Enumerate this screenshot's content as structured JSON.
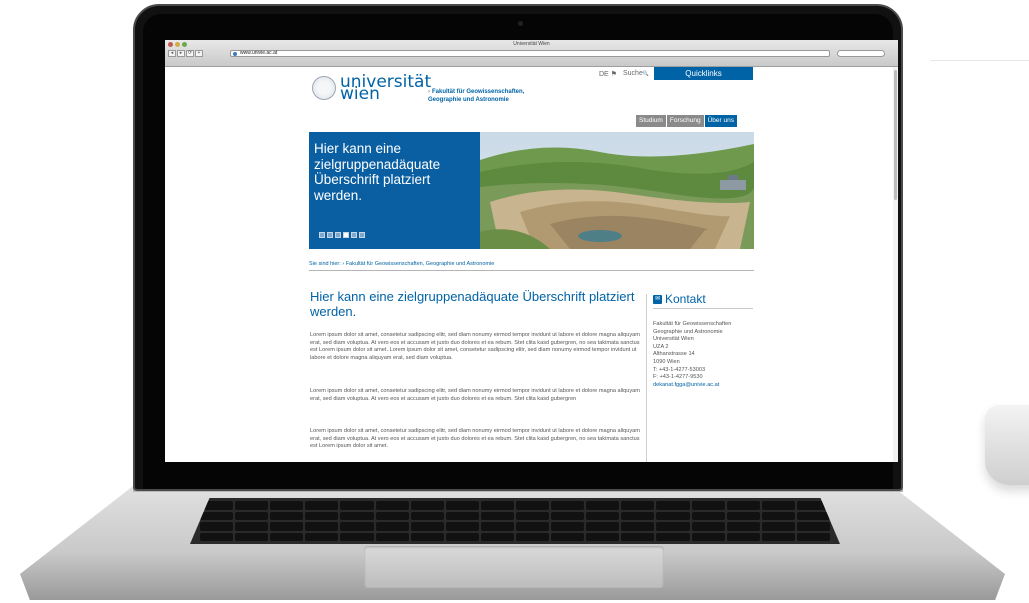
{
  "browser": {
    "window_title": "Universität Wien",
    "url": "www.univie.ac.at",
    "nav_glyphs": [
      "◂",
      "▸",
      "⟳",
      "+"
    ]
  },
  "header": {
    "logo_line1": "universität",
    "logo_line2": "wien",
    "faculty_arrow": "›",
    "faculty_line1": "Fakultät für Geowissenschaften,",
    "faculty_line2": "Geographie und Astronomie",
    "lang": "DE ⚑",
    "search_label": "Suche",
    "search_icon": "🔍",
    "quicklinks": "Quicklinks"
  },
  "mainnav": [
    "Studium",
    "Forschung",
    "Über uns"
  ],
  "hero": {
    "title": "Hier kann eine zielgruppenadäquate Überschrift platziert werden.",
    "slides_total": 6,
    "slide_active": 4
  },
  "breadcrumb": {
    "label": "Sie sind hier:",
    "path": "› Fakultät für Geowissenschaften, Geographie und Astronomie"
  },
  "content": {
    "heading": "Hier kann eine zielgruppenadäquate Überschrift platziert werden.",
    "paragraphs": [
      "Lorem ipsum dolor sit amet, consetetur sadipscing elitr, sed diam nonumy eirmod tempor invidunt ut labore et dolore magna aliquyam erat, sed diam voluptua. At vero eos et accusam et justo duo dolores et ea rebum. Stet clita kasd gubergren, no sea takimata sanctus est Lorem ipsum dolor sit amet. Lorem ipsum dolor sit amet, consetetur sadipscing elitr, sed diam nonumy eirmod tempor invidunt ut labore et dolore magna aliquyam erat, sed diam voluptua.",
      "Lorem ipsum dolor sit amet, consetetur sadipscing elitr, sed diam nonumy eirmod tempor invidunt ut labore et dolore magna aliquyam erat, sed diam voluptua. At vero eos et accusam et justo duo dolores et ea rebum. Stet clita kasd gubergren",
      "Lorem ipsum dolor sit amet, consetetur sadipscing elitr, sed diam nonumy eirmod tempor invidunt ut labore et dolore magna aliquyam erat, sed diam voluptua. At vero eos et accusam et justo duo dolores et ea rebum. Stet clita kasd gubergren, no sea takimata sanctus est Lorem ipsum dolor sit amet."
    ]
  },
  "kontakt": {
    "title": "Kontakt",
    "lines": [
      "Fakultät für Geowissenschaften",
      "Geographie und Astronomie",
      "Universität Wien",
      "UZA 2",
      "Althanstrasse 14",
      "1090 Wien",
      "T: +43-1-4277-53003",
      "F: +43-1-4277-9530"
    ],
    "email": "dekanat.fgga@univie.ac.at"
  },
  "colors": {
    "brand_blue": "#0063a6",
    "nav_gray": "#8a8a8a"
  }
}
